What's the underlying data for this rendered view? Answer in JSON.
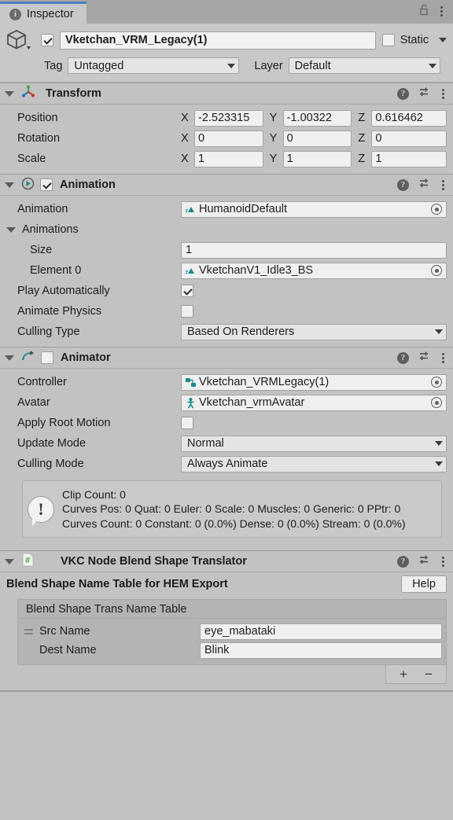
{
  "window": {
    "tab_label": "Inspector",
    "tab_icon": "info-icon",
    "lock_icon": "unlocked-padlock-icon",
    "menu_icon": "kebab-menu-icon"
  },
  "object_header": {
    "prefab_icon": "cube-icon",
    "enabled": true,
    "name": "Vketchan_VRM_Legacy(1)",
    "static_checked": false,
    "static_label": "Static",
    "tag_label": "Tag",
    "tag_value": "Untagged",
    "layer_label": "Layer",
    "layer_value": "Default"
  },
  "components": [
    {
      "id": "transform",
      "title": "Transform",
      "icon": "transform-gizmo-icon",
      "has_enable_checkbox": false,
      "rows": [
        {
          "label": "Position",
          "axes": [
            {
              "axis": "X",
              "value": "-2.523315"
            },
            {
              "axis": "Y",
              "value": "-1.00322"
            },
            {
              "axis": "Z",
              "value": "0.616462"
            }
          ]
        },
        {
          "label": "Rotation",
          "axes": [
            {
              "axis": "X",
              "value": "0"
            },
            {
              "axis": "Y",
              "value": "0"
            },
            {
              "axis": "Z",
              "value": "0"
            }
          ]
        },
        {
          "label": "Scale",
          "axes": [
            {
              "axis": "X",
              "value": "1"
            },
            {
              "axis": "Y",
              "value": "1"
            },
            {
              "axis": "Z",
              "value": "1"
            }
          ]
        }
      ]
    },
    {
      "id": "animation",
      "title": "Animation",
      "icon": "animation-play-icon",
      "has_enable_checkbox": true,
      "enabled": true
    },
    {
      "id": "animator",
      "title": "Animator",
      "icon": "animator-arrow-icon",
      "has_enable_checkbox": true,
      "enabled": false
    },
    {
      "id": "vkc",
      "title": "VKC Node Blend Shape Translator",
      "icon": "csharp-script-icon",
      "has_enable_checkbox": false
    }
  ],
  "animation": {
    "clip_label": "Animation",
    "clip_value": "HumanoidDefault",
    "clip_icon": "animation-clip-icon",
    "animations_label": "Animations",
    "size_label": "Size",
    "size_value": "1",
    "element0_label": "Element 0",
    "element0_value": "VketchanV1_Idle3_BS",
    "element0_icon": "animation-clip-icon",
    "play_automatically_label": "Play Automatically",
    "play_automatically_checked": true,
    "animate_physics_label": "Animate Physics",
    "animate_physics_checked": false,
    "culling_type_label": "Culling Type",
    "culling_type_value": "Based On Renderers"
  },
  "animator": {
    "controller_label": "Controller",
    "controller_value": "Vketchan_VRMLegacy(1)",
    "controller_icon": "animator-controller-icon",
    "avatar_label": "Avatar",
    "avatar_value": "Vketchan_vrmAvatar",
    "avatar_icon": "avatar-icon",
    "apply_root_motion_label": "Apply Root Motion",
    "apply_root_motion_checked": false,
    "update_mode_label": "Update Mode",
    "update_mode_value": "Normal",
    "culling_mode_label": "Culling Mode",
    "culling_mode_value": "Always Animate",
    "info_icon": "warning-speech-bubble-icon",
    "info_text": "Clip Count: 0\nCurves Pos: 0 Quat: 0 Euler: 0 Scale: 0 Muscles: 0 Generic: 0 PPtr: 0\nCurves Count: 0 Constant: 0 (0.0%) Dense: 0 (0.0%) Stream: 0 (0.0%)"
  },
  "vkc": {
    "subtitle": "Blend Shape Name Table for HEM Export",
    "help_button": "Help",
    "list_header": "Blend Shape Trans Name Table",
    "rows": [
      {
        "label": "Src Name",
        "value": "eye_mabataki",
        "has_handle": true
      },
      {
        "label": "Dest Name",
        "value": "Blink",
        "has_handle": false
      }
    ],
    "add_button": "+",
    "remove_button": "−"
  },
  "colors": {
    "panel_bg": "#c2c2c2",
    "header_bg": "#c8c8c8",
    "tabbar_bg": "#a5a5a5",
    "tab_accent": "#4a7fc1",
    "field_bg": "#f0f0f0",
    "list_bg": "#b4b4b4",
    "teal_accent": "#1a7f7f",
    "green_accent": "#4aa14a",
    "red_accent": "#c0392b",
    "blue_accent": "#2f6fbf"
  }
}
